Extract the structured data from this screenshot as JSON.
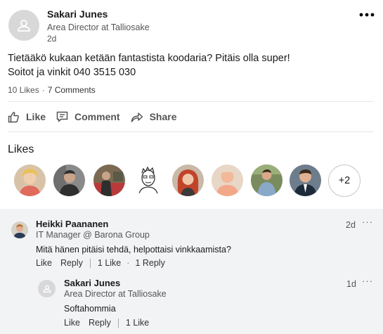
{
  "post": {
    "author_name": "Sakari Junes",
    "author_title": "Area Director at Talliosake",
    "age": "2d",
    "menu_icon": "more-dots-icon",
    "text_lines": [
      "Tietääkö kukaan ketään fantastista koodaria? Pitäis olla super!",
      "Soitot ja vinkit 040 3515 030"
    ],
    "likes_count": "10 Likes",
    "comments_count": "7 Comments",
    "separator": "·"
  },
  "actions": {
    "like_label": "Like",
    "comment_label": "Comment",
    "share_label": "Share",
    "like_icon": "thumbs-up-icon",
    "comment_icon": "comment-bubble-icon",
    "share_icon": "share-arrow-icon"
  },
  "likes_section": {
    "title": "Likes",
    "more_label": "+2",
    "likers": [
      {
        "name": "liker-1",
        "colors": [
          "#d9c3a8",
          "#e8c15c"
        ]
      },
      {
        "name": "liker-2",
        "colors": [
          "#8a8a8a",
          "#2f2f2f"
        ]
      },
      {
        "name": "liker-3",
        "colors": [
          "#7b6a52",
          "#b83a3a"
        ]
      },
      {
        "name": "liker-4",
        "colors": [
          "#ffffff",
          "#333333"
        ]
      },
      {
        "name": "liker-5",
        "colors": [
          "#c9b9a8",
          "#c1442a"
        ]
      },
      {
        "name": "liker-6",
        "colors": [
          "#e8d6c6",
          "#f3a88a"
        ]
      },
      {
        "name": "liker-7",
        "colors": [
          "#7a8c5e",
          "#8aa9c9"
        ]
      },
      {
        "name": "liker-8",
        "colors": [
          "#6d7d8c",
          "#1d2a3a"
        ]
      }
    ]
  },
  "comments": [
    {
      "name": "Heikki Paananen",
      "title": "IT Manager @ Barona Group",
      "text": "Mitä hänen pitäisi tehdä, helpottaisi vinkkaamista?",
      "age": "2d",
      "like_label": "Like",
      "reply_label": "Reply",
      "like_count": "1 Like",
      "separator": "·",
      "reply_count": "1 Reply"
    },
    {
      "name": "Sakari Junes",
      "title": "Area Director at Talliosake",
      "text": "Softahommia",
      "age": "1d",
      "like_label": "Like",
      "reply_label": "Reply",
      "like_count": "1 Like"
    }
  ],
  "comment_menu_icon": "more-dots-icon",
  "colors": {
    "comments_background": "#f2f3f5",
    "divider": "#e6e6e6",
    "secondary_text": "#555555"
  }
}
